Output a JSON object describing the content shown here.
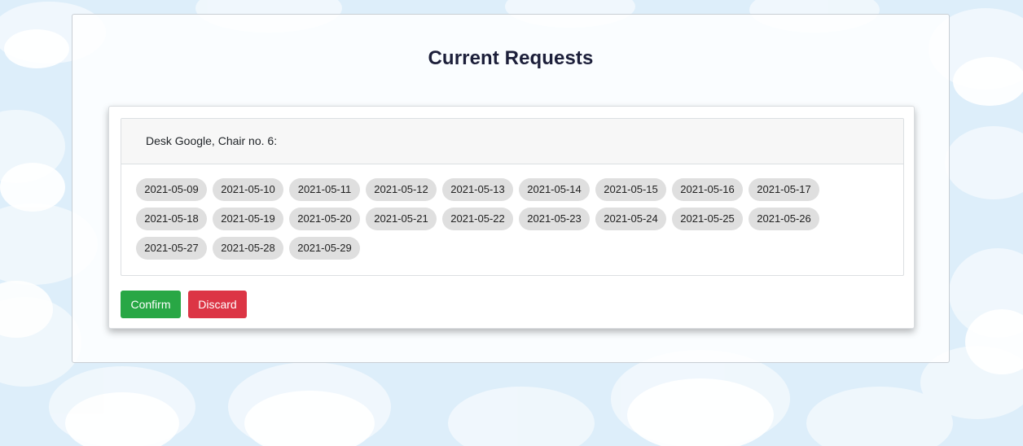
{
  "page": {
    "title": "Current Requests"
  },
  "request": {
    "label": "Desk Google, Chair no. 6:",
    "dates": [
      "2021-05-09",
      "2021-05-10",
      "2021-05-11",
      "2021-05-12",
      "2021-05-13",
      "2021-05-14",
      "2021-05-15",
      "2021-05-16",
      "2021-05-17",
      "2021-05-18",
      "2021-05-19",
      "2021-05-20",
      "2021-05-21",
      "2021-05-22",
      "2021-05-23",
      "2021-05-24",
      "2021-05-25",
      "2021-05-26",
      "2021-05-27",
      "2021-05-28",
      "2021-05-29"
    ]
  },
  "actions": {
    "confirm_label": "Confirm",
    "discard_label": "Discard"
  },
  "colors": {
    "confirm": "#28a745",
    "discard": "#dc3545",
    "sky": "#ddeefa",
    "title": "#1c1f3a"
  }
}
